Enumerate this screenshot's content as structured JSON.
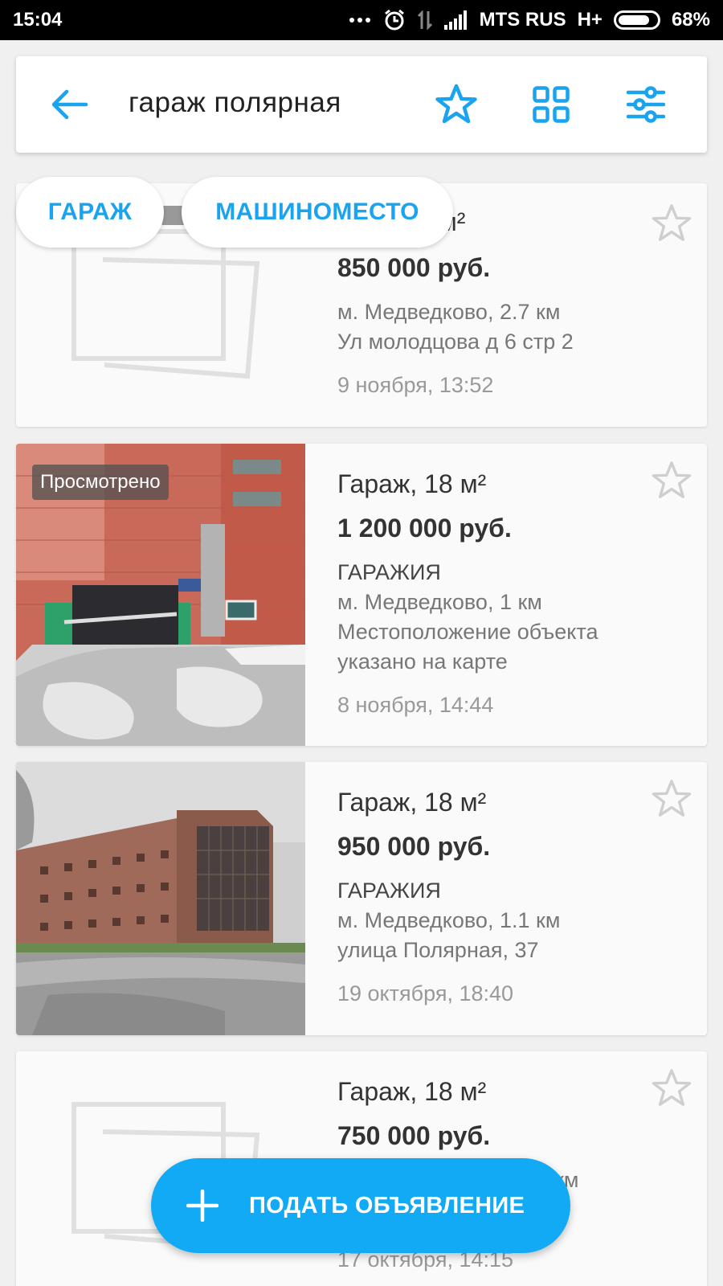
{
  "status_bar": {
    "time": "15:04",
    "carrier": "MTS RUS",
    "network": "H+",
    "battery": "68%",
    "battery_level": 0.68
  },
  "header": {
    "back_icon": "arrow-left-icon",
    "query": "гараж полярная",
    "favorite_icon": "star-outline-icon",
    "grid_icon": "grid-icon",
    "filter_icon": "sliders-icon",
    "accent_color": "#1aa3ee"
  },
  "chips": [
    "ГАРАЖ",
    "МАШИНОМЕСТО"
  ],
  "listings": [
    {
      "title_partial": "8 м²",
      "price": "850 000 руб.",
      "metro": "м. Медведково,",
      "distance": "2.7 км",
      "address": "Ул молодцова д 6 стр 2",
      "date": "9 ноября, 13:52",
      "has_photo": false
    },
    {
      "badge": "Просмотрено",
      "title": "Гараж, 18 м²",
      "price": "1 200 000 руб.",
      "seller": "ГАРАЖИЯ",
      "metro": "м. Медведково,",
      "distance": "1 км",
      "address_line1": "Местоположение объекта",
      "address_line2": "указано на карте",
      "date": "8 ноября, 14:44",
      "has_photo": true
    },
    {
      "title": "Гараж, 18 м²",
      "price": "950 000 руб.",
      "seller": "ГАРАЖИЯ",
      "metro": "м. Медведково,",
      "distance": "1.1 км",
      "address": "улица Полярная, 37",
      "date": "19 октября, 18:40",
      "has_photo": true
    },
    {
      "title": "Гараж, 18 м²",
      "price": "750 000 руб.",
      "distance_partial": "км",
      "date": "17 октября, 14:15",
      "has_photo": false
    }
  ],
  "fab": {
    "label": "ПОДАТЬ ОБЪЯВЛЕНИЕ",
    "icon": "plus-icon",
    "color": "#12aaf5"
  }
}
